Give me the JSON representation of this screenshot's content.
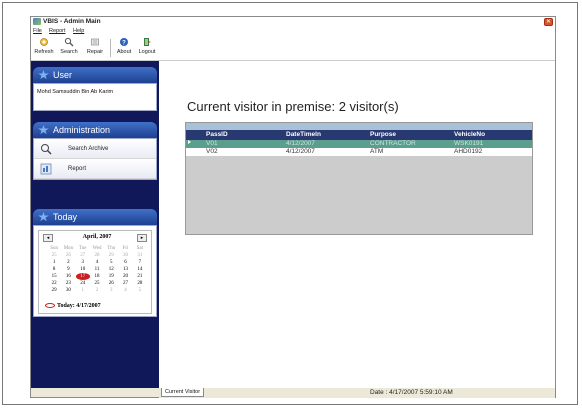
{
  "window": {
    "title": "VBIS - Admin Main"
  },
  "menu": [
    "File",
    "Report",
    "Help"
  ],
  "toolbar": {
    "buttons": [
      "Refresh",
      "Search",
      "Repair",
      "About",
      "Logout"
    ]
  },
  "sidebar": {
    "user": {
      "heading": "User",
      "name": "Mohd Samsuddin Bin Ab Karim"
    },
    "administration": {
      "heading": "Administration",
      "items": [
        "Search Archive",
        "Report"
      ]
    },
    "today": {
      "heading": "Today",
      "calendar": {
        "month_label": "April, 2007",
        "prev": "◂",
        "next": "▸",
        "weekdays": [
          "Sun",
          "Mon",
          "Tue",
          "Wed",
          "Thu",
          "Fri",
          "Sat"
        ],
        "weeks": [
          [
            "25",
            "26",
            "27",
            "28",
            "29",
            "30",
            "31"
          ],
          [
            "1",
            "2",
            "3",
            "4",
            "5",
            "6",
            "7"
          ],
          [
            "8",
            "9",
            "10",
            "11",
            "12",
            "13",
            "14"
          ],
          [
            "15",
            "16",
            "17",
            "18",
            "19",
            "20",
            "21"
          ],
          [
            "22",
            "23",
            "24",
            "25",
            "26",
            "27",
            "28"
          ],
          [
            "29",
            "30",
            "1",
            "2",
            "3",
            "4",
            "5"
          ]
        ],
        "selected_day": "17",
        "today_label": "Today: 4/17/2007"
      }
    }
  },
  "main": {
    "title": "Current visitor in premise: 2 visitor(s)",
    "table": {
      "columns": [
        "PassID",
        "DateTimeIn",
        "Purpose",
        "VehicleNo"
      ],
      "rows": [
        [
          "V01",
          "4/12/2007",
          "CONTRACTOR",
          "WSK0191"
        ],
        [
          "V02",
          "4/12/2007",
          "ATM",
          "AHD0192"
        ]
      ]
    },
    "tab": "Current Visitor"
  },
  "status": {
    "date": "Date : 4/17/2007 5:59:10 AM"
  },
  "colors": {
    "sidebar_bg": "#10185a",
    "grid_header": "#283870",
    "selected_row": "#5a9e8e",
    "accent": "#4070c8"
  }
}
